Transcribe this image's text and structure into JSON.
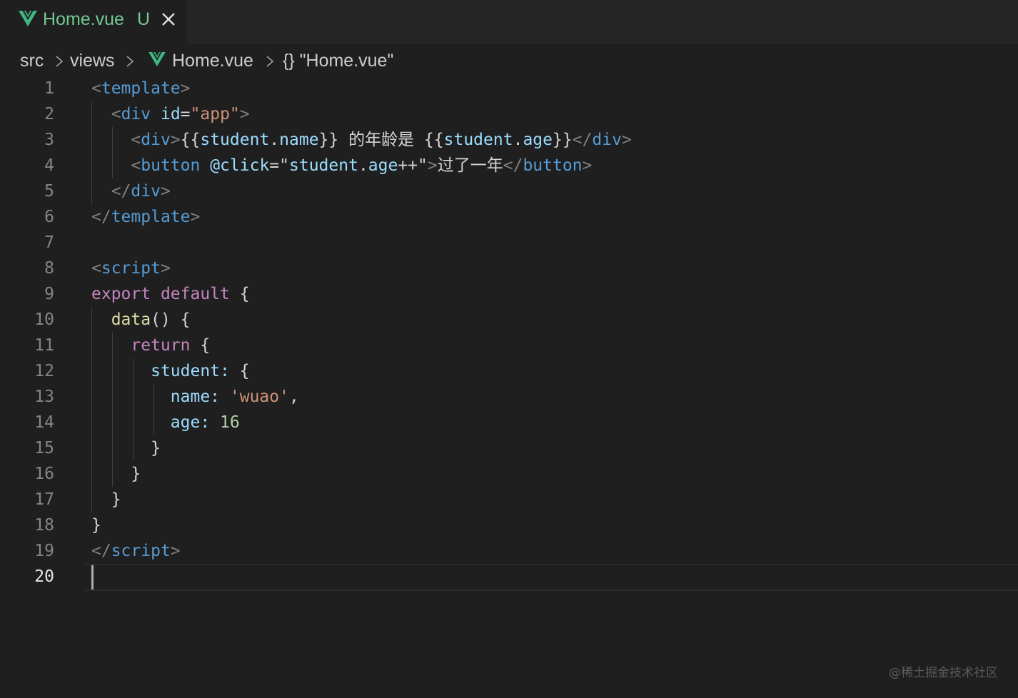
{
  "tab": {
    "filename": "Home.vue",
    "status": "U",
    "icon": "vue-icon",
    "close_icon": "close-icon"
  },
  "breadcrumb": {
    "items": [
      "src",
      "views",
      "Home.vue",
      "{} \"Home.vue\""
    ]
  },
  "editor": {
    "active_line": 20,
    "line_numbers": [
      "1",
      "2",
      "3",
      "4",
      "5",
      "6",
      "7",
      "8",
      "9",
      "10",
      "11",
      "12",
      "13",
      "14",
      "15",
      "16",
      "17",
      "18",
      "19",
      "20"
    ],
    "lines": [
      [
        [
          "t-bracket",
          "<"
        ],
        [
          "t-tag",
          "template"
        ],
        [
          "t-bracket",
          ">"
        ]
      ],
      [
        [
          "t-text",
          "  "
        ],
        [
          "t-bracket",
          "<"
        ],
        [
          "t-tag",
          "div"
        ],
        [
          "t-text",
          " "
        ],
        [
          "t-attr",
          "id"
        ],
        [
          "t-text",
          "="
        ],
        [
          "t-str",
          "\"app\""
        ],
        [
          "t-bracket",
          ">"
        ]
      ],
      [
        [
          "t-text",
          "    "
        ],
        [
          "t-bracket",
          "<"
        ],
        [
          "t-tag",
          "div"
        ],
        [
          "t-bracket",
          ">"
        ],
        [
          "t-text",
          "{{"
        ],
        [
          "t-expr",
          "student"
        ],
        [
          "t-text",
          "."
        ],
        [
          "t-expr",
          "name"
        ],
        [
          "t-text",
          "}} 的年龄是 {{"
        ],
        [
          "t-expr",
          "student"
        ],
        [
          "t-text",
          "."
        ],
        [
          "t-expr",
          "age"
        ],
        [
          "t-text",
          "}}"
        ],
        [
          "t-bracket",
          "</"
        ],
        [
          "t-tag",
          "div"
        ],
        [
          "t-bracket",
          ">"
        ]
      ],
      [
        [
          "t-text",
          "    "
        ],
        [
          "t-bracket",
          "<"
        ],
        [
          "t-tag",
          "button"
        ],
        [
          "t-text",
          " "
        ],
        [
          "t-attr",
          "@click"
        ],
        [
          "t-text",
          "=\""
        ],
        [
          "t-expr",
          "student"
        ],
        [
          "t-text",
          "."
        ],
        [
          "t-expr",
          "age"
        ],
        [
          "t-text",
          "++\""
        ],
        [
          "t-bracket",
          ">"
        ],
        [
          "t-text",
          "过了一年"
        ],
        [
          "t-bracket",
          "</"
        ],
        [
          "t-tag",
          "button"
        ],
        [
          "t-bracket",
          ">"
        ]
      ],
      [
        [
          "t-text",
          "  "
        ],
        [
          "t-bracket",
          "</"
        ],
        [
          "t-tag",
          "div"
        ],
        [
          "t-bracket",
          ">"
        ]
      ],
      [
        [
          "t-bracket",
          "</"
        ],
        [
          "t-tag",
          "template"
        ],
        [
          "t-bracket",
          ">"
        ]
      ],
      [],
      [
        [
          "t-bracket",
          "<"
        ],
        [
          "t-tag",
          "script"
        ],
        [
          "t-bracket",
          ">"
        ]
      ],
      [
        [
          "t-kw",
          "export"
        ],
        [
          "t-text",
          " "
        ],
        [
          "t-kw",
          "default"
        ],
        [
          "t-text",
          " {"
        ]
      ],
      [
        [
          "t-text",
          "  "
        ],
        [
          "t-fn",
          "data"
        ],
        [
          "t-text",
          "() {"
        ]
      ],
      [
        [
          "t-text",
          "    "
        ],
        [
          "t-kw",
          "return"
        ],
        [
          "t-text",
          " {"
        ]
      ],
      [
        [
          "t-text",
          "      "
        ],
        [
          "t-prop",
          "student"
        ],
        [
          "t-prop",
          ":"
        ],
        [
          "t-text",
          " {"
        ]
      ],
      [
        [
          "t-text",
          "        "
        ],
        [
          "t-prop",
          "name"
        ],
        [
          "t-prop",
          ":"
        ],
        [
          "t-text",
          " "
        ],
        [
          "t-str",
          "'wuao'"
        ],
        [
          "t-text",
          ","
        ]
      ],
      [
        [
          "t-text",
          "        "
        ],
        [
          "t-prop",
          "age"
        ],
        [
          "t-prop",
          ":"
        ],
        [
          "t-text",
          " "
        ],
        [
          "t-num",
          "16"
        ]
      ],
      [
        [
          "t-text",
          "      }"
        ]
      ],
      [
        [
          "t-text",
          "    }"
        ]
      ],
      [
        [
          "t-text",
          "  }"
        ]
      ],
      [
        [
          "t-text",
          "}"
        ]
      ],
      [
        [
          "t-bracket",
          "</"
        ],
        [
          "t-tag",
          "script"
        ],
        [
          "t-bracket",
          ">"
        ]
      ],
      []
    ]
  },
  "watermark": "@稀土掘金技术社区",
  "colors": {
    "background": "#1f1f1f",
    "tab_label": "#73c991",
    "tag": "#569cd6",
    "attribute": "#9cdcfe",
    "string": "#ce9178",
    "keyword": "#c586c0",
    "function": "#dcdcaa",
    "number": "#b5cea8"
  }
}
